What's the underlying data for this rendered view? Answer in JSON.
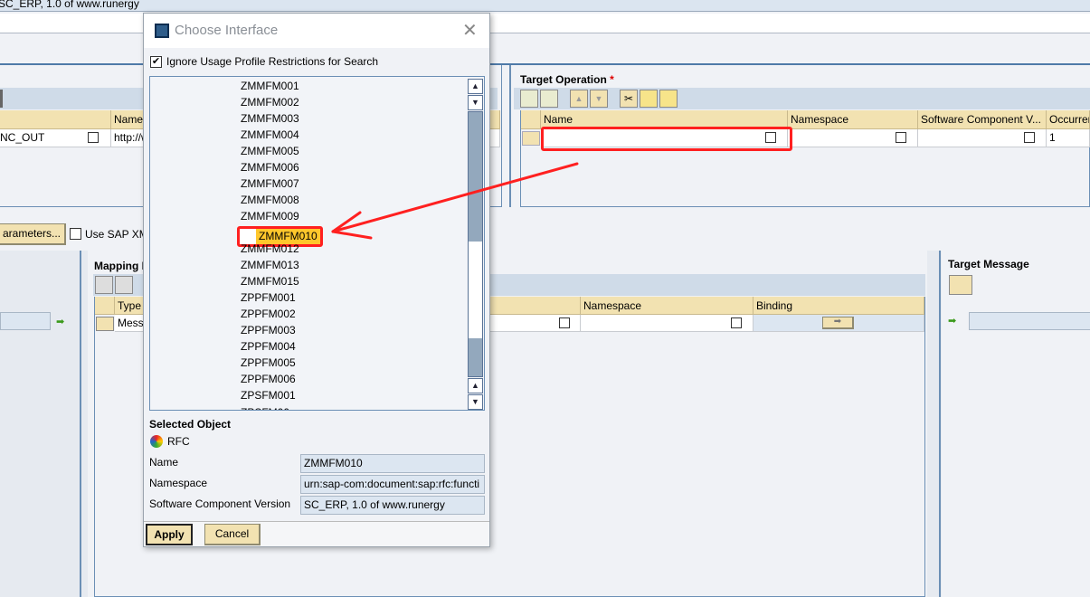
{
  "background": {
    "top_text": "SC_ERP, 1.0 of www.runergy",
    "source_table": {
      "header_name": "Name",
      "row_name": "NC_OUT",
      "row_namespace": "http://w"
    },
    "parameters_button": "arameters...",
    "use_sap_xml_label": "Use SAP XM",
    "target_operation": {
      "title": "Target Operation",
      "required_mark": "*",
      "columns": [
        "Name",
        "Namespace",
        "Software Component V...",
        "Occurren"
      ],
      "row": {
        "name": "",
        "namespace": "",
        "scv": "",
        "occurrence": "1"
      }
    },
    "mapping": {
      "title": "Mapping P",
      "columns": [
        "Type",
        "Namespace",
        "Binding"
      ],
      "row_type": "Mess"
    },
    "target_message": {
      "title": "Target Message"
    }
  },
  "dialog": {
    "title": "Choose Interface",
    "ignore_checkbox": {
      "label": "Ignore Usage Profile Restrictions for Search",
      "checked": true
    },
    "items": [
      "ZMMFM001",
      "ZMMFM002",
      "ZMMFM003",
      "ZMMFM004",
      "ZMMFM005",
      "ZMMFM006",
      "ZMMFM007",
      "ZMMFM008",
      "ZMMFM009",
      "ZMMFM010",
      "ZMMFM012",
      "ZMMFM013",
      "ZMMFM015",
      "ZPPFM001",
      "ZPPFM002",
      "ZPPFM003",
      "ZPPFM004",
      "ZPPFM005",
      "ZPPFM006",
      "ZPSFM001"
    ],
    "selected_item": "ZMMFM010",
    "selected_object": {
      "heading": "Selected Object",
      "type": "RFC",
      "name_label": "Name",
      "name_value": "ZMMFM010",
      "namespace_label": "Namespace",
      "namespace_value": "urn:sap-com:document:sap:rfc:functi",
      "scv_label": "Software Component Version",
      "scv_value": "SC_ERP, 1.0 of www.runergy"
    },
    "apply_label": "Apply",
    "cancel_label": "Cancel"
  },
  "colors": {
    "highlight": "#ffc72c",
    "annotation": "#ff2020",
    "header": "#f2e2b1"
  }
}
